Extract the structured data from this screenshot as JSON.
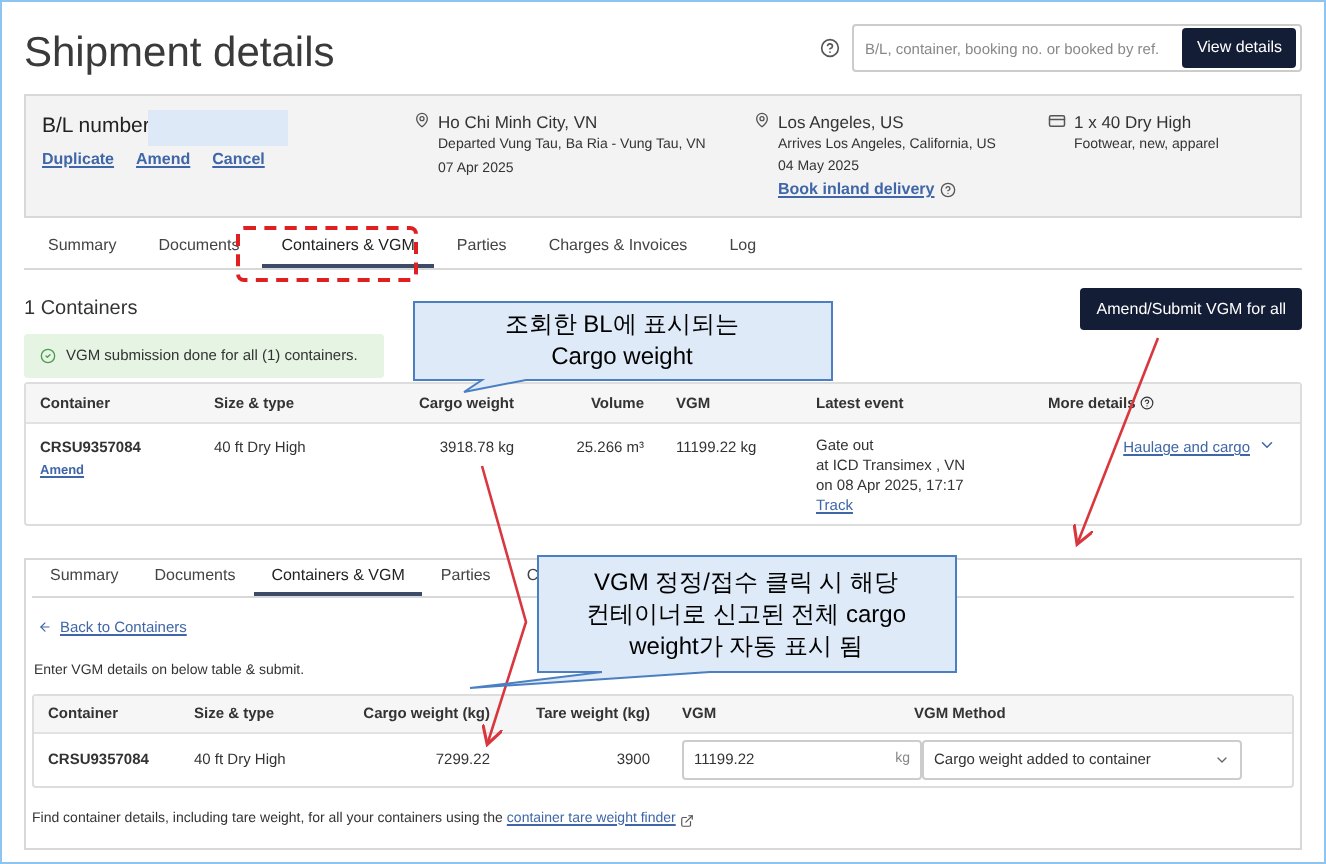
{
  "header": {
    "title": "Shipment details",
    "search_placeholder": "B/L, container, booking no. or booked by ref.",
    "view_button": "View details"
  },
  "shipment": {
    "bl_label": "B/L number",
    "actions": [
      "Duplicate",
      "Amend",
      "Cancel"
    ],
    "origin": {
      "city": "Ho Chi Minh City, VN",
      "detail": "Departed Vung Tau, Ba Ria - Vung Tau, VN",
      "date": "07 Apr 2025"
    },
    "destination": {
      "city": "Los Angeles, US",
      "detail": "Arrives Los Angeles, California, US",
      "date": "04 May 2025",
      "link": "Book inland delivery"
    },
    "cargo": {
      "summary": "1 x 40 Dry High",
      "description": "Footwear, new, apparel"
    }
  },
  "tabs": [
    {
      "label": "Summary",
      "selected": false
    },
    {
      "label": "Documents",
      "selected": false
    },
    {
      "label": "Containers & VGM",
      "selected": true
    },
    {
      "label": "Parties",
      "selected": false
    },
    {
      "label": "Charges & Invoices",
      "selected": false
    },
    {
      "label": "Log",
      "selected": false
    }
  ],
  "containers": {
    "count": "1 Containers",
    "submit_button": "Amend/Submit VGM for all",
    "alert": "VGM submission done for all (1) containers.",
    "columns": [
      "Container",
      "Size & type",
      "Cargo weight",
      "Volume",
      "VGM",
      "Latest event",
      "More details"
    ],
    "rows": [
      {
        "container": "CRSU9357084",
        "amend": "Amend",
        "size": "40 ft Dry High",
        "cargo_weight": "3918.78 kg",
        "volume": "25.266 m³",
        "vgm": "11199.22 kg",
        "event": [
          "Gate out",
          "at ICD Transimex , VN",
          "on 08 Apr 2025, 17:17"
        ],
        "track": "Track",
        "details_link": "Haulage and cargo"
      }
    ]
  },
  "vgm_panel": {
    "tabs": [
      {
        "label": "Summary",
        "selected": false
      },
      {
        "label": "Documents",
        "selected": false
      },
      {
        "label": "Containers & VGM",
        "selected": true
      },
      {
        "label": "Parties",
        "selected": false
      },
      {
        "label": "C",
        "selected": false
      }
    ],
    "back_link": "Back to Containers",
    "instruction": "Enter VGM details on below table & submit.",
    "columns": [
      "Container",
      "Size & type",
      "Cargo weight (kg)",
      "Tare weight (kg)",
      "VGM",
      "VGM Method"
    ],
    "rows": [
      {
        "container": "CRSU9357084",
        "size": "40 ft Dry High",
        "cargo_weight": "7299.22",
        "tare_weight": "3900",
        "vgm": "11199.22",
        "unit": "kg",
        "method": "Cargo weight added to container"
      }
    ],
    "footer": "Find container details, including tare weight, for all your containers using the",
    "footer_link": "container tare weight finder"
  },
  "annotations": [
    {
      "lines": [
        "조회한 BL에 표시되는",
        "Cargo weight"
      ]
    },
    {
      "lines": [
        "VGM 정정/접수 클릭 시 해당",
        "컨테이너로 신고된 전체 cargo",
        "weight가 자동 표시 됨"
      ]
    }
  ]
}
